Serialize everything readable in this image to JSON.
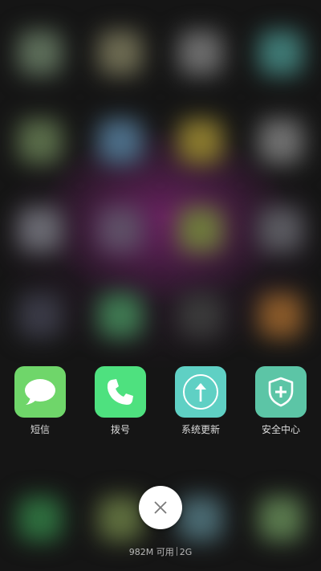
{
  "background_apps": {
    "icon_colors": [
      "#5d6e5a",
      "#6d6b52",
      "#6c6c6c",
      "#3f7a75",
      "#5a6d4a",
      "#4c6e88",
      "#8a7a2e",
      "#707070",
      "#6a6a72",
      "#5e4f66",
      "#6e7a3c",
      "#5a5a60",
      "#3a3a46",
      "#3f7a52",
      "#3a3a3a",
      "#8a5a2a",
      "#2e6e3e",
      "#5e6e3e",
      "#4a6a72",
      "#5a7a4e"
    ]
  },
  "dock_apps": [
    {
      "label": "短信",
      "icon": "message-bubble-icon",
      "color": "#6fd66a"
    },
    {
      "label": "拨号",
      "icon": "phone-handset-icon",
      "color": "#4ee17f"
    },
    {
      "label": "系统更新",
      "icon": "upload-arrow-icon",
      "color": "#5fd0c4"
    },
    {
      "label": "安全中心",
      "icon": "shield-plus-icon",
      "color": "#5cc5a6"
    }
  ],
  "close_button": {
    "icon": "close-icon"
  },
  "memory_status": {
    "available": "982M 可用",
    "network": "2G"
  }
}
